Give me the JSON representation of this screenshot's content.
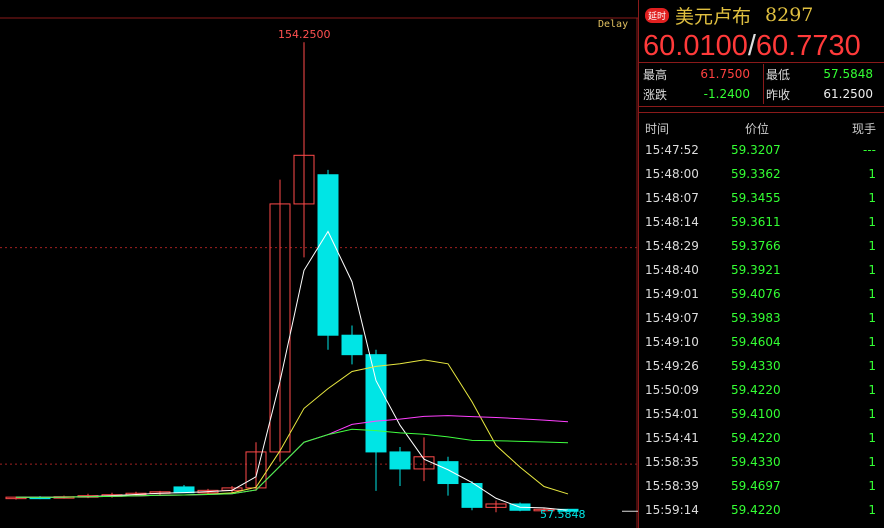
{
  "chart": {
    "delay_label": "Delay",
    "high_label": "154.2500",
    "low_label": "57.5848",
    "candles": [
      {
        "o": 60.6,
        "h": 60.8,
        "l": 60.2,
        "c": 60.7
      },
      {
        "o": 60.7,
        "h": 60.9,
        "l": 60.3,
        "c": 60.6
      },
      {
        "o": 60.6,
        "h": 61.0,
        "l": 60.4,
        "c": 60.8
      },
      {
        "o": 60.8,
        "h": 61.4,
        "l": 60.5,
        "c": 61.0
      },
      {
        "o": 61.0,
        "h": 61.6,
        "l": 60.6,
        "c": 61.2
      },
      {
        "o": 61.2,
        "h": 61.8,
        "l": 60.9,
        "c": 61.5
      },
      {
        "o": 61.5,
        "h": 62.0,
        "l": 61.1,
        "c": 61.8
      },
      {
        "o": 62.8,
        "h": 63.2,
        "l": 62.2,
        "c": 61.6
      },
      {
        "o": 61.6,
        "h": 62.4,
        "l": 61.2,
        "c": 62.1
      },
      {
        "o": 62.1,
        "h": 63.0,
        "l": 61.6,
        "c": 62.6
      },
      {
        "o": 62.6,
        "h": 72.0,
        "l": 62.0,
        "c": 70.0
      },
      {
        "o": 70.0,
        "h": 126.0,
        "l": 68.0,
        "c": 121.0
      },
      {
        "o": 121.0,
        "h": 154.25,
        "l": 110.0,
        "c": 131.0
      },
      {
        "o": 127.0,
        "h": 128.0,
        "l": 91.0,
        "c": 94.0
      },
      {
        "o": 94.0,
        "h": 96.0,
        "l": 88.0,
        "c": 90.0
      },
      {
        "o": 90.0,
        "h": 91.0,
        "l": 62.0,
        "c": 70.0
      },
      {
        "o": 70.0,
        "h": 71.0,
        "l": 63.0,
        "c": 66.5
      },
      {
        "o": 66.5,
        "h": 73.0,
        "l": 64.0,
        "c": 69.0
      },
      {
        "o": 68.0,
        "h": 69.0,
        "l": 61.0,
        "c": 63.5
      },
      {
        "o": 63.5,
        "h": 64.0,
        "l": 58.0,
        "c": 58.6
      },
      {
        "o": 58.6,
        "h": 60.0,
        "l": 57.6,
        "c": 59.3
      },
      {
        "o": 59.3,
        "h": 59.6,
        "l": 57.8,
        "c": 58.0
      },
      {
        "o": 58.0,
        "h": 58.5,
        "l": 57.6,
        "c": 58.2
      },
      {
        "o": 58.2,
        "h": 58.3,
        "l": 57.5848,
        "c": 57.8
      }
    ],
    "ma_colors": [
      "#ffffff",
      "#e8e840",
      "#ff40ff",
      "#40ff40"
    ],
    "dashed_levels": [
      112,
      67.5
    ],
    "ylim": [
      56,
      158
    ]
  },
  "header": {
    "badge": "延时",
    "name": "美元卢布",
    "code": "8297",
    "bid": "60.0100",
    "sep": "/",
    "ask": "60.7730"
  },
  "stats": {
    "high_label": "最高",
    "high_value": "61.7500",
    "low_label": "最低",
    "low_value": "57.5848",
    "change_label": "涨跌",
    "change_value": "-1.2400",
    "prev_label": "昨收",
    "prev_value": "61.2500"
  },
  "ticks_header": {
    "time": "时间",
    "price": "价位",
    "volume": "现手"
  },
  "ticks": [
    {
      "time": "15:47:52",
      "price": "59.3207",
      "volume": "---"
    },
    {
      "time": "15:48:00",
      "price": "59.3362",
      "volume": "1"
    },
    {
      "time": "15:48:07",
      "price": "59.3455",
      "volume": "1"
    },
    {
      "time": "15:48:14",
      "price": "59.3611",
      "volume": "1"
    },
    {
      "time": "15:48:29",
      "price": "59.3766",
      "volume": "1"
    },
    {
      "time": "15:48:40",
      "price": "59.3921",
      "volume": "1"
    },
    {
      "time": "15:49:01",
      "price": "59.4076",
      "volume": "1"
    },
    {
      "time": "15:49:07",
      "price": "59.3983",
      "volume": "1"
    },
    {
      "time": "15:49:10",
      "price": "59.4604",
      "volume": "1"
    },
    {
      "time": "15:49:26",
      "price": "59.4330",
      "volume": "1"
    },
    {
      "time": "15:50:09",
      "price": "59.4220",
      "volume": "1"
    },
    {
      "time": "15:54:01",
      "price": "59.4100",
      "volume": "1"
    },
    {
      "time": "15:54:41",
      "price": "59.4220",
      "volume": "1"
    },
    {
      "time": "15:58:35",
      "price": "59.4330",
      "volume": "1"
    },
    {
      "time": "15:58:39",
      "price": "59.4697",
      "volume": "1"
    },
    {
      "time": "15:59:14",
      "price": "59.4220",
      "volume": "1"
    }
  ]
}
